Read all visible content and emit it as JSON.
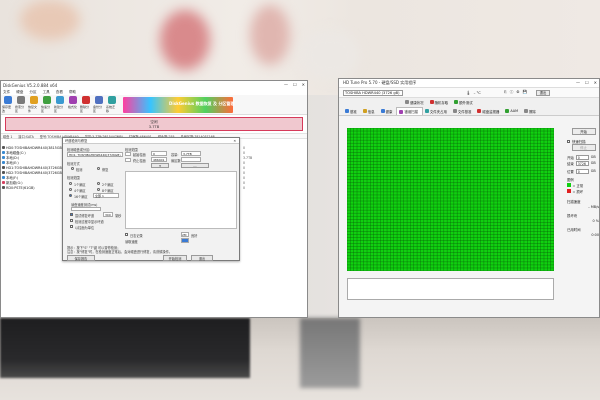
{
  "left_window": {
    "title": "DiskGenius V5.2.0.884 x64",
    "menu": [
      "文件",
      "硬盘",
      "分区",
      "工具",
      "查看",
      "帮助"
    ],
    "toolbar": [
      "保存更改",
      "搜索分区",
      "恢复文件",
      "快速分区",
      "新建分区",
      "格式化",
      "删除分区",
      "备份分区",
      "系统迁移"
    ],
    "banner_text": "DiskGenius 数据恢复 及 分区管理",
    "status_label": "空闲",
    "status_size": "3.7TB",
    "info_bar": [
      "磁盘 1",
      "接口:SATA",
      "型号:TOSHIBA HDWR440",
      "序列号:XXXXXXXX",
      "容量:3.7TB(3815447MB)",
      "柱面数:486401",
      "磁头数:255",
      "每道扇区数:63",
      "总扇区数:7814037168"
    ],
    "tree": [
      {
        "label": "HD0:TOSHIBAHDWR440(3815GB)",
        "color": "#555"
      },
      {
        "label": "本地磁盘(C:)",
        "color": "#3a8ad0"
      },
      {
        "label": "本地(D:)",
        "color": "#3a8ad0"
      },
      {
        "label": "本地(E:)",
        "color": "#3a8ad0"
      },
      {
        "label": "HD1:TOSHIBAHDWR440(3726GB)",
        "color": "#555"
      },
      {
        "label": "HD2:TOSHIBAHDWR440(3726GB)",
        "color": "#555"
      },
      {
        "label": "本地(F:)",
        "color": "#3a8ad0"
      },
      {
        "label": "新加卷(G:)",
        "color": "#d64060"
      },
      {
        "label": "RD0:PSTE(61GB)",
        "color": "#555"
      }
    ],
    "right_values": [
      "0",
      "0",
      "3.7TB",
      "0",
      "0",
      "0",
      "0",
      "0",
      "0"
    ],
    "dialog": {
      "title": "坏道检测与修复",
      "disk_label": "检测磁盘或分区:",
      "disk_value": "HD1: TOSHIBAHDWR440(3726GB)",
      "mode_label": "检测方式",
      "mode_options": [
        "检测",
        "修复"
      ],
      "range_label": "检测范围",
      "cyl_from_label": "起始柱面",
      "cyl_from": "0",
      "cyl_to_label": "终止柱面",
      "cyl_to": "486401",
      "size_label": "容量:",
      "size_value": "3.7TB",
      "sector_label": "扇区数:",
      "timeout_label": "超时时间",
      "timeout": "300",
      "timeout_unit": "毫秒",
      "detect_options": [
        "1个扇区",
        "2个扇区",
        "4个扇区",
        "8个扇区",
        "16个扇区",
        "32个扇区"
      ],
      "selected_option": "全部 1",
      "speed_label": "读盘速度测试(ms)",
      "check1": "尝试修复坏道",
      "check2": "检测过程中显示坏道",
      "check3": "以柱面为单位",
      "check4": "日志记录",
      "legend": "",
      "legend_box": "2M",
      "good_label": "良好",
      "progress_label": "读取速度",
      "bottom_note1": "提示：按下\"S\" \"T\"键 可以暂停检测；",
      "bottom_note2": "注意：按\"修复\"时，在检测速度正常后，会对磁盘进行修复，请谨慎操作。",
      "btn_start": "开始检测",
      "btn_save": "保存报告",
      "btn_close": "退出"
    },
    "bottom_info": [
      {
        "k": "总柱面",
        "v": "486401"
      },
      {
        "k": "已检查",
        "v": "0"
      },
      {
        "k": "坏道数",
        "v": "0"
      }
    ],
    "bottom_right": "3815447MB(3.7TB)"
  },
  "right_window": {
    "title": "HD Tune Pro 5.70 - 硬盘/SSD 实用程序",
    "drive": "TOSHIBA HDWR440 (3726 gB)",
    "temp": "– °C",
    "exit_label": "退出",
    "tabs_row1": [
      "健康状况",
      "随机存取",
      "额外测试"
    ],
    "tabs_row2": [
      "基准",
      "信息",
      "健康",
      "错误扫描",
      "文件夹占用",
      "文件基准",
      "磁盘监视器",
      "AAM",
      "擦除"
    ],
    "active_tab": "错误扫描",
    "grid": {
      "cols": 62,
      "rows": 47,
      "color": "#10d010",
      "line": "#0a5a0a"
    },
    "side": {
      "start_btn": "开始",
      "quick_scan": "快速扫描",
      "stop_btn": "停止",
      "start_label": "开始",
      "start_val": "0",
      "end_label": "结束",
      "end_val": "3726",
      "position_label": "位置",
      "position_val": "0",
      "unit": "GB",
      "legend_title": "图例",
      "legend_ok": "= 正常",
      "legend_bad": "= 损坏",
      "progress_label": "扫描速度",
      "speed_val": "– MB/s",
      "damaged_label": "损坏块",
      "damaged_val": "0 %",
      "elapsed_label": "已用时间",
      "elapsed_val": "0:00"
    }
  }
}
